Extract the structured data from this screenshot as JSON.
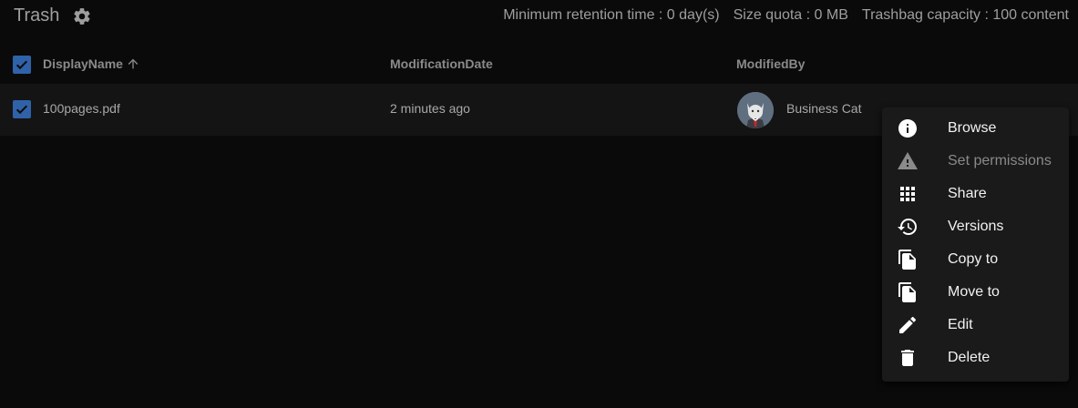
{
  "header": {
    "title": "Trash",
    "settings_icon": "gear-icon",
    "retention": "Minimum retention time : 0 day(s)",
    "quota": "Size quota : 0 MB",
    "capacity": "Trashbag capacity : 100 content"
  },
  "table": {
    "columns": [
      "DisplayName",
      "ModificationDate",
      "ModifiedBy"
    ],
    "sort_icon": "arrow-up-icon",
    "rows": [
      {
        "selected": true,
        "display_name": "100pages.pdf",
        "modification_date": "2 minutes ago",
        "modified_by": "Business Cat",
        "avatar_icon": "cat-avatar"
      }
    ]
  },
  "context_menu": {
    "items": [
      {
        "label": "Browse",
        "icon": "info-icon",
        "disabled": false
      },
      {
        "label": "Set permissions",
        "icon": "warning-icon",
        "disabled": true
      },
      {
        "label": "Share",
        "icon": "apps-grid-icon",
        "disabled": false
      },
      {
        "label": "Versions",
        "icon": "history-icon",
        "disabled": false
      },
      {
        "label": "Copy to",
        "icon": "copy-icon",
        "disabled": false
      },
      {
        "label": "Move to",
        "icon": "move-icon",
        "disabled": false
      },
      {
        "label": "Edit",
        "icon": "pencil-icon",
        "disabled": false
      },
      {
        "label": "Delete",
        "icon": "trash-icon",
        "disabled": false
      }
    ]
  },
  "colors": {
    "background": "#0a0a0a",
    "checkbox": "#2f62a8",
    "menu_background": "#1a1a1a"
  }
}
